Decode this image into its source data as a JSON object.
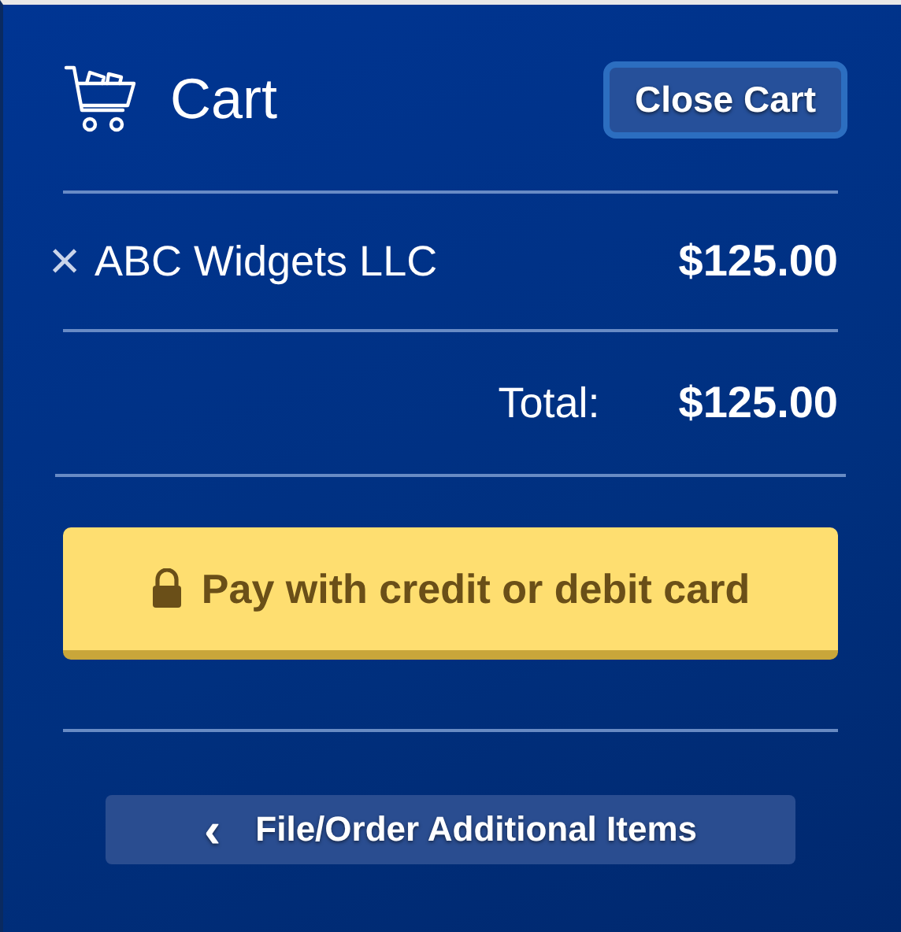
{
  "header": {
    "title": "Cart",
    "close_button": "Close Cart"
  },
  "items": [
    {
      "name": "ABC Widgets LLC",
      "price": "$125.00",
      "remove": "×"
    }
  ],
  "total": {
    "label": "Total:",
    "amount": "$125.00"
  },
  "pay_button": "Pay with credit or debit card",
  "back_button": {
    "icon": "‹",
    "label": "File/Order Additional Items"
  }
}
